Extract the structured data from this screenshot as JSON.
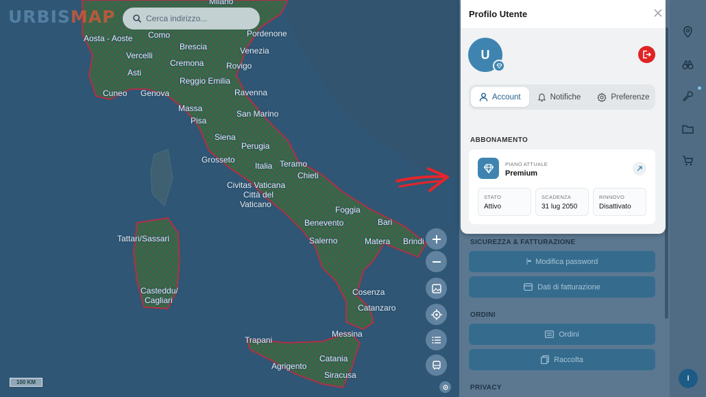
{
  "map": {
    "logo_text_a": "URBIS",
    "logo_text_b": "MAP",
    "search_placeholder": "Cerca indirizzo...",
    "scale_label": "100 KM",
    "cities": [
      {
        "name": "Milano"
      },
      {
        "name": "Aosta - Aoste"
      },
      {
        "name": "Como"
      },
      {
        "name": "Pordenone"
      },
      {
        "name": "Brescia"
      },
      {
        "name": "Venezia"
      },
      {
        "name": "Vercelli"
      },
      {
        "name": "Cremona"
      },
      {
        "name": "Rovigo"
      },
      {
        "name": "Asti"
      },
      {
        "name": "Reggio Emilia"
      },
      {
        "name": "Cuneo"
      },
      {
        "name": "Genova"
      },
      {
        "name": "Ravenna"
      },
      {
        "name": "Massa"
      },
      {
        "name": "San Marino"
      },
      {
        "name": "Pisa"
      },
      {
        "name": "Siena"
      },
      {
        "name": "Perugia"
      },
      {
        "name": "Grosseto"
      },
      {
        "name": "Italia"
      },
      {
        "name": "Teramo"
      },
      {
        "name": "Chieti"
      },
      {
        "name": "Civitas Vaticana"
      },
      {
        "name": "Città del"
      },
      {
        "name": "Vaticano"
      },
      {
        "name": "Foggia"
      },
      {
        "name": "Bari"
      },
      {
        "name": "Benevento"
      },
      {
        "name": "Tattari/Sassari"
      },
      {
        "name": "Salerno"
      },
      {
        "name": "Matera"
      },
      {
        "name": "Brindi"
      },
      {
        "name": "Casteddu/"
      },
      {
        "name": "Cagliari"
      },
      {
        "name": "Cosenza"
      },
      {
        "name": "Catanzaro"
      },
      {
        "name": "Messina"
      },
      {
        "name": "Trapani"
      },
      {
        "name": "Catania"
      },
      {
        "name": "Agrigento"
      },
      {
        "name": "Siracusa"
      }
    ]
  },
  "profile": {
    "title": "Profilo Utente",
    "avatar_initial": "U",
    "tabs": [
      {
        "label": "Account",
        "active": true
      },
      {
        "label": "Notifiche",
        "active": false
      },
      {
        "label": "Preferenze",
        "active": false
      }
    ],
    "subscription_section": "ABBONAMENTO",
    "plan_label": "PIANO ATTUALE",
    "plan_name": "Premium",
    "stats": [
      {
        "key": "STATO",
        "value": "Attivo"
      },
      {
        "key": "SCADENZA",
        "value": "31 lug 2050"
      },
      {
        "key": "RINNOVO",
        "value": "Disattivato"
      }
    ],
    "security_section": "SICUREZZA & FATTURAZIONE",
    "change_password": "Modifica password",
    "billing_data": "Dati di fatturazione",
    "orders_section": "ORDINI",
    "orders_button": "Ordini",
    "collection_button": "Raccolta",
    "privacy_section": "PRIVACY"
  },
  "sidebar": {
    "user_initial": "I",
    "icons": [
      "location-pin-icon",
      "binoculars-icon",
      "wrench-icon",
      "folder-icon",
      "cart-icon"
    ]
  },
  "colors": {
    "accent": "#3f84b0",
    "logout": "#e02424",
    "map_sea": "#2f5675",
    "land_fill": "#2d6b4a",
    "border_red": "#b03045"
  }
}
